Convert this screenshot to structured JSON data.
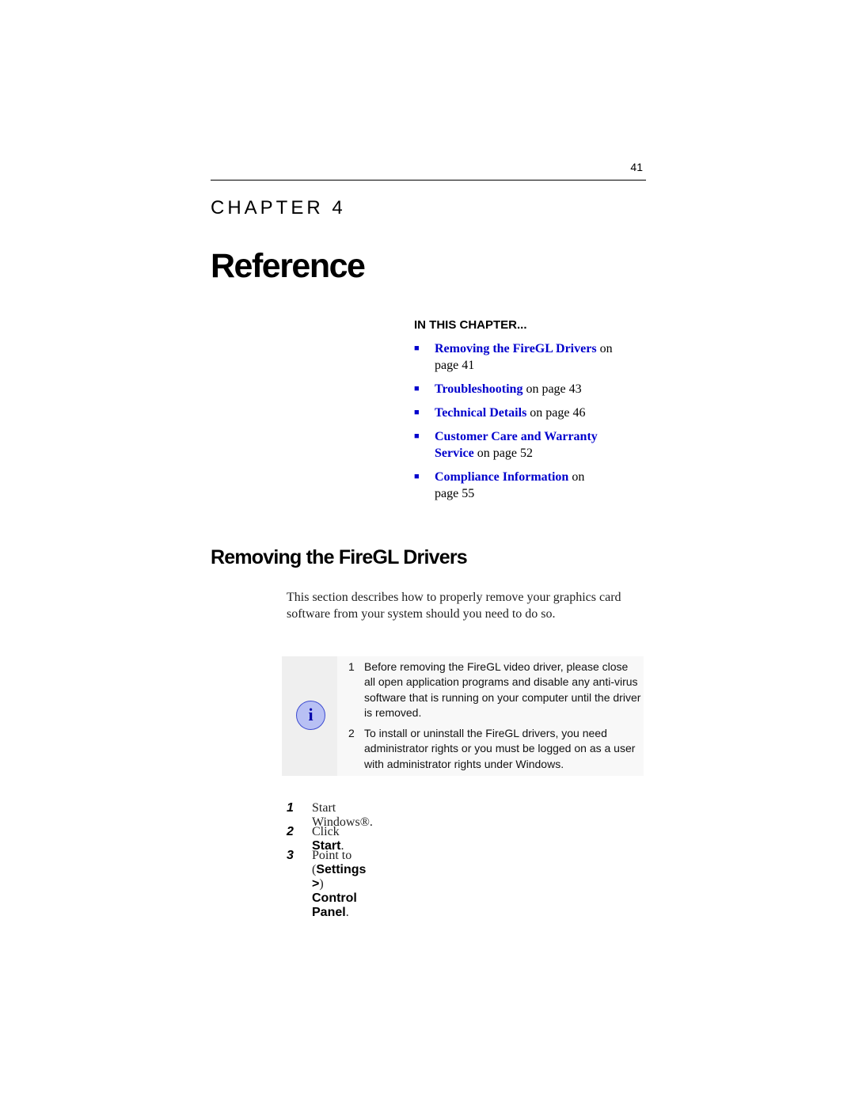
{
  "header": {
    "page_number": "41"
  },
  "chapter": {
    "label": "CHAPTER 4",
    "title": "Reference"
  },
  "in_this_chapter": {
    "heading": "IN THIS CHAPTER...",
    "items": [
      {
        "link": "Removing the FireGL Drivers",
        "suffix": " on page 41"
      },
      {
        "link": "Troubleshooting",
        "suffix": " on page 43"
      },
      {
        "link": "Technical Details",
        "suffix": " on page 46"
      },
      {
        "link": "Customer Care and Warranty Service",
        "suffix": " on page 52"
      },
      {
        "link": "Compliance Information",
        "suffix": " on page 55"
      }
    ]
  },
  "section": {
    "heading": "Removing the FireGL Drivers",
    "intro": "This section describes how to properly remove your graphics card software from your system should you need to do so."
  },
  "note": {
    "icon": "info-icon",
    "items": [
      {
        "num": "1",
        "text": "Before removing the FireGL video driver, please close all open application programs and disable any anti-virus software that is running on your computer until the driver is removed."
      },
      {
        "num": "2",
        "text": "To install or uninstall the FireGL drivers, you need administrator rights or you must be logged on as a user with administrator rights under Windows."
      }
    ]
  },
  "steps": [
    {
      "num": "1",
      "pre": "Start Windows®.",
      "bold1": "",
      "mid": "",
      "bold2": "",
      "post": ""
    },
    {
      "num": "2",
      "pre": "Click ",
      "bold1": "Start",
      "mid": "",
      "bold2": "",
      "post": "."
    },
    {
      "num": "3",
      "pre": "Point to (",
      "bold1": "Settings >",
      "mid": ") ",
      "bold2": "Control Panel",
      "post": "."
    }
  ]
}
